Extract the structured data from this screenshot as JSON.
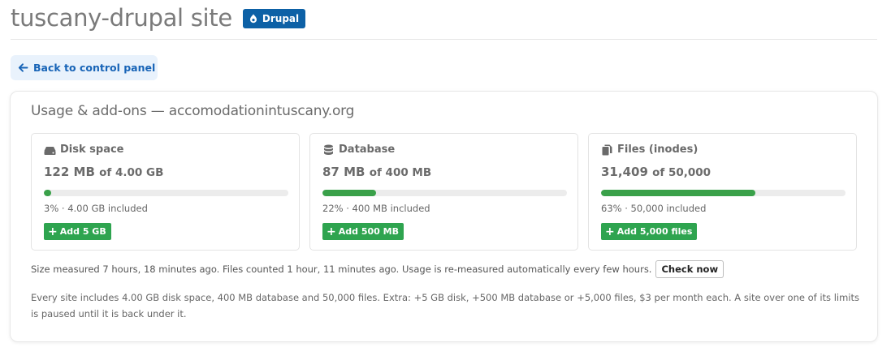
{
  "header": {
    "title": "tuscany-drupal site",
    "badge": "Drupal",
    "badge_icon": "drupal-drop-icon",
    "badge_color": "#0d61a6"
  },
  "back_button": {
    "label": "Back to control panel",
    "icon": "arrow-left-icon"
  },
  "panel": {
    "title": "Usage & add-ons — accomodationintuscany.org"
  },
  "cards": [
    {
      "icon": "hard-drive-icon",
      "label": "Disk space",
      "used": "122 MB",
      "of": "of 4.00 GB",
      "percent": 3,
      "sub": "3% · 4.00 GB included",
      "add_label": "Add 5 GB"
    },
    {
      "icon": "database-icon",
      "label": "Database",
      "used": "87 MB",
      "of": "of 400 MB",
      "percent": 22,
      "sub": "22% · 400 MB included",
      "add_label": "Add 500 MB"
    },
    {
      "icon": "files-icon",
      "label": "Files (inodes)",
      "used": "31,409",
      "of": "of 50,000",
      "percent": 63,
      "sub": "63% · 50,000 included",
      "add_label": "Add 5,000 files"
    }
  ],
  "measure": {
    "text": "Size measured 7 hours, 18 minutes ago. Files counted 1 hour, 11 minutes ago. Usage is re-measured automatically every few hours.",
    "check_label": "Check now"
  },
  "info_text": "Every site includes 4.00 GB disk space, 400 MB database and 50,000 files. Extra: +5 GB disk, +500 MB database or +5,000 files, $3 per month each. A site over one of its limits is paused until it is back under it.",
  "colors": {
    "accent": "#1864b7",
    "progress": "#3aa14a",
    "add_button": "#2ea44f"
  }
}
